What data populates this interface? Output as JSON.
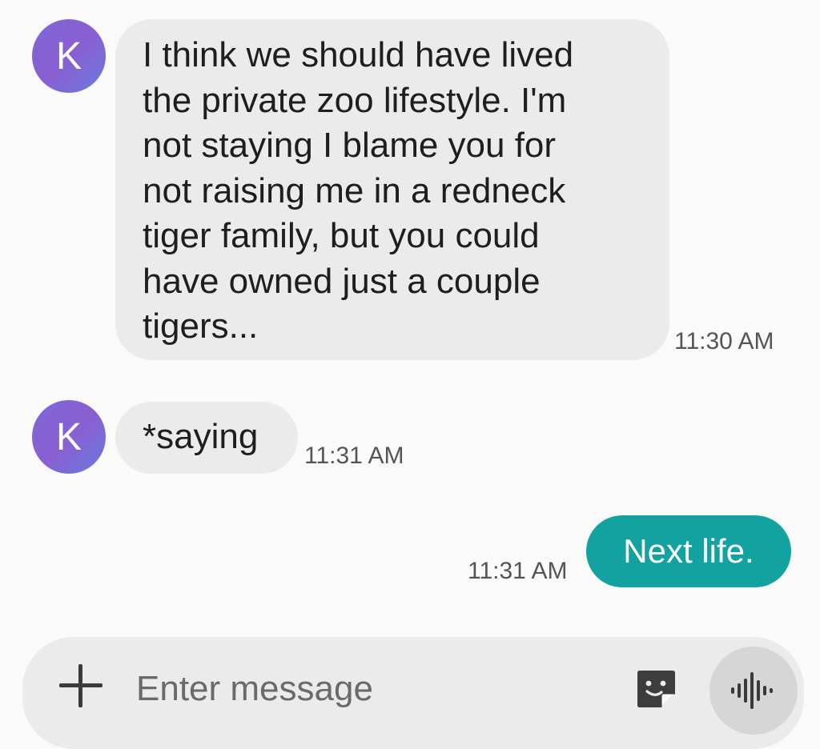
{
  "contact": {
    "initial": "K",
    "avatar_gradient": [
      "#7c67d8",
      "#6a79e0"
    ]
  },
  "messages": [
    {
      "direction": "incoming",
      "text": "I think we should have lived\nthe private zoo lifestyle. I'm\nnot staying I blame you for\nnot raising me in a redneck\ntiger family, but you could\nhave owned just a couple\ntigers...",
      "time": "11:30 AM"
    },
    {
      "direction": "incoming",
      "text": "*saying",
      "time": "11:31 AM"
    },
    {
      "direction": "outgoing",
      "text": "Next life.",
      "time": "11:31 AM"
    }
  ],
  "composer": {
    "placeholder": "Enter message",
    "value": "",
    "add_icon": "plus-icon",
    "sticker_icon": "sticker-icon",
    "voice_icon": "voice-waveform-icon"
  },
  "colors": {
    "incoming_bubble": "#ebebeb",
    "outgoing_bubble": "#12a3a0",
    "background": "#fafafa"
  }
}
